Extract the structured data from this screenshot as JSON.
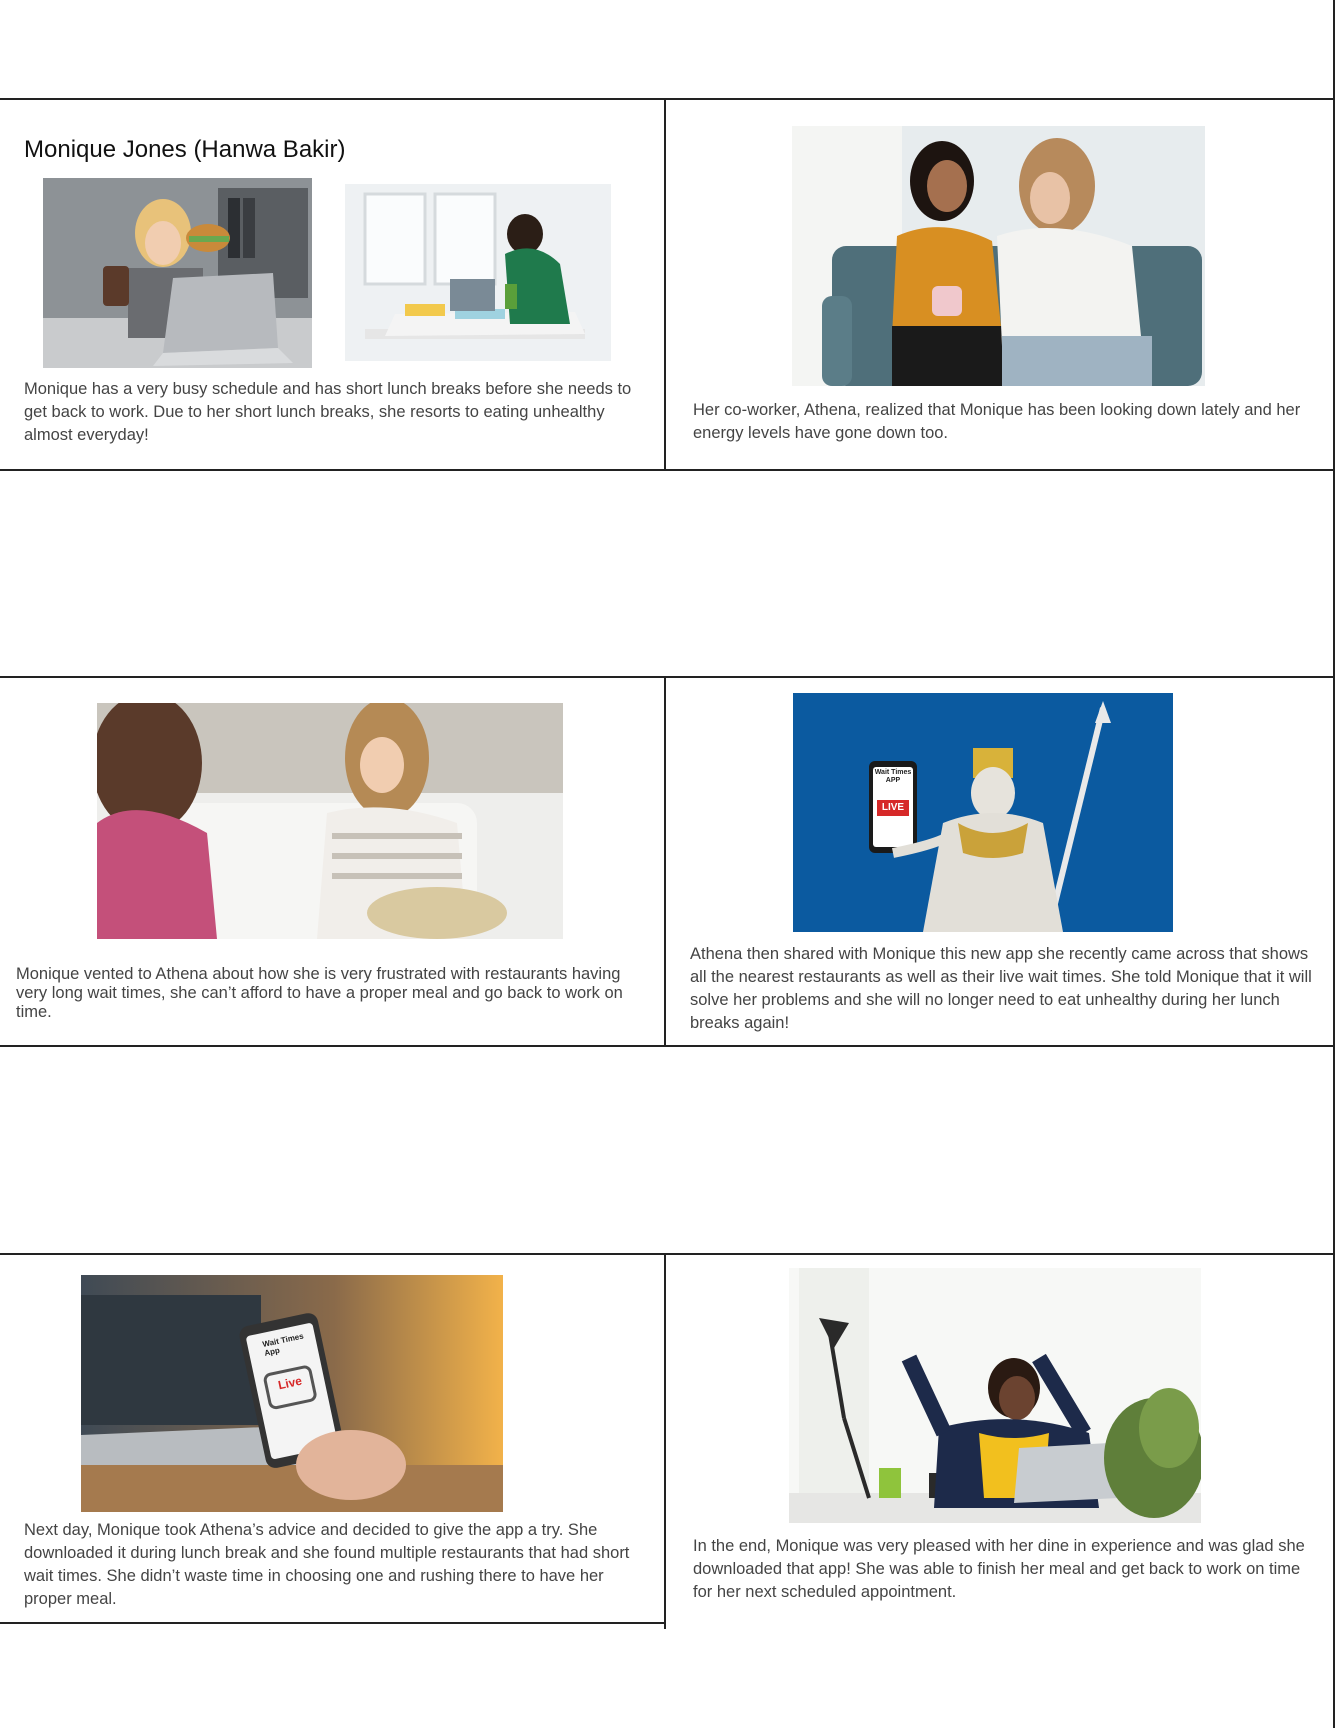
{
  "storyboard": {
    "title": "Monique Jones (Hanwa Bakir)",
    "panels": [
      {
        "caption": "Monique has a very busy schedule and has short lunch breaks before she needs to get back to work. Due to her short lunch breaks, she resorts to eating unhealthy almost everyday!"
      },
      {
        "caption": "Her co-worker, Athena, realized that Monique has been looking down lately and her energy levels have gone down too."
      },
      {
        "caption": "Monique vented to Athena about how she is very frustrated with restaurants having very long wait times, she can’t afford to have a proper meal and go back to work on time."
      },
      {
        "caption": "Athena then shared with Monique this new app she recently came across that shows all the nearest restaurants as well as their live wait times. She told Monique that it will solve her problems and she will no longer need to eat unhealthy during her lunch breaks again!"
      },
      {
        "caption": "Next day, Monique took Athena’s advice and decided to give the app a try. She downloaded it during lunch break and she found multiple restaurants that had short wait times. She didn’t waste time in choosing one and rushing there to have her proper meal."
      },
      {
        "caption": "In the end, Monique was very pleased with her dine in experience and was glad she downloaded that app! She was able to finish her meal and get back to work on time for her next scheduled appointment."
      }
    ],
    "app_screen_1": {
      "title": "Wait Times APP",
      "badge": "LIVE"
    },
    "app_screen_2": {
      "title": "Wait Times App",
      "badge": "Live"
    },
    "colors": {
      "border": "#222222",
      "caption": "#444444",
      "athena_bg": "#0b5aa0",
      "live_red": "#d62828"
    }
  }
}
